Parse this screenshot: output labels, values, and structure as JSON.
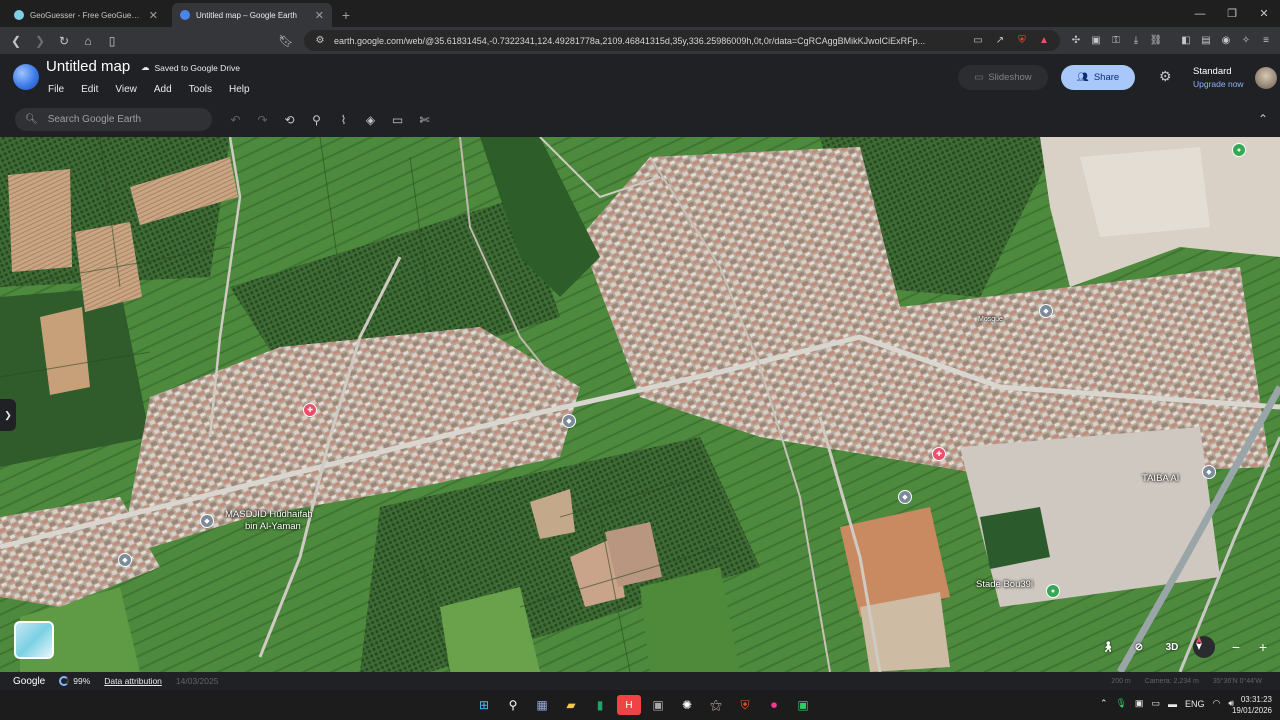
{
  "browser": {
    "tabs": [
      {
        "title": "GeoGuesser - Free GeoGuessr Alt...",
        "active": false,
        "favicon_color": "#7fd0e6"
      },
      {
        "title": "Untitled map – Google Earth",
        "active": true,
        "favicon_color": "#4a86e8"
      }
    ],
    "url": "earth.google.com/web/@35.61831454,-0.7322341,124.49281778a,2109.46841315d,35y,336.25986009h,0t,0r/data=CgRCAggBMikKJwolCiExRFp...",
    "icons": [
      "back-icon",
      "forward-icon",
      "reload-icon",
      "home-icon",
      "sidebar-icon",
      "bookmark-icon",
      "site-settings-icon"
    ]
  },
  "earth": {
    "doc_title": "Untitled map",
    "saved_status": "Saved to Google Drive",
    "menus": [
      "File",
      "Edit",
      "View",
      "Add",
      "Tools",
      "Help"
    ],
    "slideshow_label": "Slideshow",
    "share_label": "Share",
    "plan_label": "Standard",
    "upgrade_label": "Upgrade now",
    "search_placeholder": "Search Google Earth"
  },
  "map": {
    "labels": {
      "mosque_top": "Mosque",
      "masjid_line1": "MASDJID Hudhaifah",
      "masjid_line2": "bin Al-Yaman",
      "taiba": "TAIBA AI",
      "stade": "Stade Bou39i"
    },
    "controls": {
      "three_d": "3D",
      "zoom_out": "−",
      "zoom_in": "+"
    }
  },
  "statusbar": {
    "brand": "Google",
    "progress": "99%",
    "attribution": "Data attribution",
    "imagery_date": "14/03/2025",
    "scale": "200 m",
    "camera": "Camera: 2,234 m",
    "coords": "35°36'N 0°44'W"
  },
  "taskbar": {
    "lang": "ENG",
    "time": "03:31:23",
    "date": "19/01/2026"
  }
}
